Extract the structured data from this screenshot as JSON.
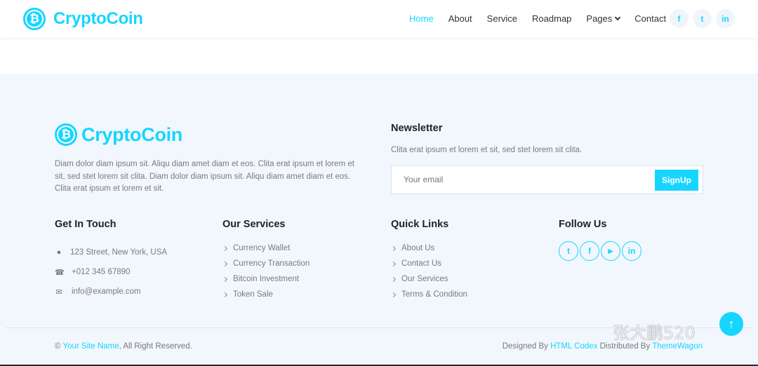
{
  "navbar": {
    "brand_name": "CryptoCoin",
    "brand_icon": "bitcoin-icon",
    "menu": [
      {
        "label": "Home",
        "active": true
      },
      {
        "label": "About"
      },
      {
        "label": "Service"
      },
      {
        "label": "Roadmap"
      },
      {
        "label": "Pages",
        "dropdown": true
      },
      {
        "label": "Contact"
      }
    ],
    "social": [
      {
        "icon": "facebook-icon",
        "glyph": "f"
      },
      {
        "icon": "twitter-icon",
        "glyph": "t"
      },
      {
        "icon": "linkedin-icon",
        "glyph": "in"
      }
    ]
  },
  "footer": {
    "brand_name": "CryptoCoin",
    "about_text": "Diam dolor diam ipsum sit. Aliqu diam amet diam et eos. Clita erat ipsum et lorem et sit, sed stet lorem sit clita. Diam dolor diam ipsum sit. Aliqu diam amet diam et eos. Clita erat ipsum et lorem et sit.",
    "newsletter": {
      "title": "Newsletter",
      "text": "Clita erat ipsum et lorem et sit, sed stet lorem sit clita.",
      "placeholder": "Your email",
      "button_label": "SignUp"
    },
    "get_in_touch": {
      "title": "Get In Touch",
      "items": [
        {
          "icon": "map-marker-icon",
          "glyph": "●",
          "text": "123 Street, New York, USA"
        },
        {
          "icon": "phone-icon",
          "glyph": "☎",
          "text": "+012 345 67890"
        },
        {
          "icon": "envelope-icon",
          "glyph": "✉",
          "text": "info@example.com"
        }
      ]
    },
    "our_services": {
      "title": "Our Services",
      "items": [
        "Currency Wallet",
        "Currency Transaction",
        "Bitcoin Investment",
        "Token Sale"
      ]
    },
    "quick_links": {
      "title": "Quick Links",
      "items": [
        "About Us",
        "Contact Us",
        "Our Services",
        "Terms & Condition"
      ]
    },
    "follow_us": {
      "title": "Follow Us",
      "social": [
        {
          "icon": "twitter-icon",
          "glyph": "t"
        },
        {
          "icon": "facebook-icon",
          "glyph": "f"
        },
        {
          "icon": "youtube-icon",
          "glyph": "▶"
        },
        {
          "icon": "linkedin-icon",
          "glyph": "in"
        }
      ]
    },
    "copyright": {
      "prefix": "© ",
      "site_name": "Your Site Name",
      "suffix": ", All Right Reserved."
    },
    "designed_by": {
      "prefix": "Designed By ",
      "designer": "HTML Codex",
      "middle": " Distributed By ",
      "distributor": "ThemeWagon"
    }
  },
  "back_to_top": {
    "icon": "arrow-up-icon",
    "glyph": "↑"
  },
  "watermark": {
    "text": "张大鹏520"
  },
  "colors": {
    "accent": "#16d5ff",
    "footer_bg": "#f2f7fd"
  }
}
